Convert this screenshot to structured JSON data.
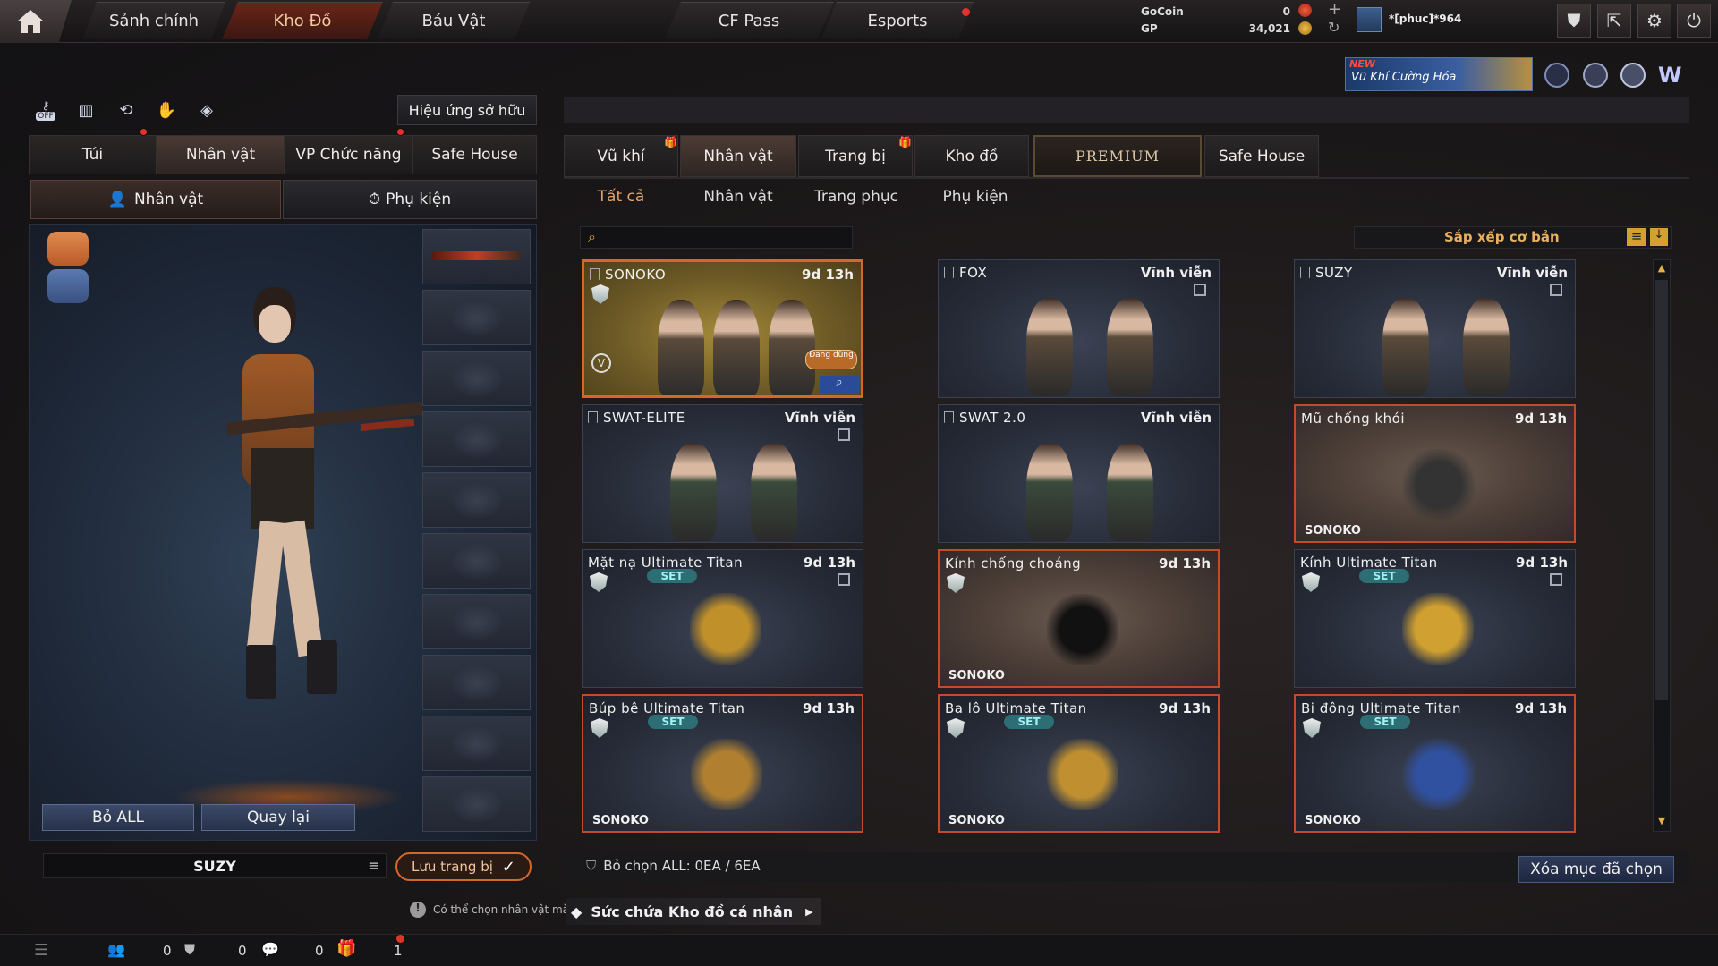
{
  "nav": {
    "tabs": [
      "Sảnh chính",
      "Kho Đồ",
      "Báu Vật",
      "CF Pass",
      "Esports"
    ],
    "active_tab": "Kho Đồ"
  },
  "currency": {
    "gocoin_label": "GoCoin",
    "gocoin_value": "0",
    "gp_label": "GP",
    "gp_value": "34,021"
  },
  "user": {
    "name": "*[phuc]*964"
  },
  "promo": {
    "badge": "NEW",
    "text": "Vũ Khí Cường Hóa"
  },
  "left": {
    "off_label": "OFF",
    "effects_button": "Hiệu ứng sở hữu",
    "tabs": [
      "Túi",
      "Nhân vật",
      "VP Chức năng",
      "Safe House"
    ],
    "active_tab": "Nhân vật",
    "subtabs": [
      "Nhân vật",
      "Phụ kiện"
    ],
    "remove_all": "Bỏ ALL",
    "back": "Quay lại",
    "character_name": "SUZY",
    "save_equip": "Lưu trang bị",
    "tip": "Có thể chọn nhân vật mà"
  },
  "right": {
    "tabs": [
      "Vũ khí",
      "Nhân vật",
      "Trang bị",
      "Kho đồ",
      "PREMIUM",
      "Safe House"
    ],
    "active_tab": "Nhân vật",
    "subtabs": [
      "Tất cả",
      "Nhân vật",
      "Trang phục",
      "Phụ kiện"
    ],
    "active_subtab": "Tất cả",
    "search_placeholder": "",
    "sort_label": "Sắp xếp cơ bản",
    "items": [
      {
        "name": "SONOKO",
        "duration": "9d 13h",
        "in_use": "Đang dùng"
      },
      {
        "name": "FOX",
        "duration": "Vĩnh viễn"
      },
      {
        "name": "SUZY",
        "duration": "Vĩnh viễn"
      },
      {
        "name": "SWAT-ELITE",
        "duration": "Vĩnh viễn"
      },
      {
        "name": "SWAT 2.0",
        "duration": "Vĩnh viễn"
      },
      {
        "name": "Mũ chống khói",
        "duration": "9d 13h",
        "owner": "SONOKO"
      },
      {
        "name": "Mặt nạ Ultimate Titan",
        "duration": "9d 13h",
        "set": "SET"
      },
      {
        "name": "Kính chống choáng",
        "duration": "9d 13h",
        "owner": "SONOKO"
      },
      {
        "name": "Kính Ultimate Titan",
        "duration": "9d 13h",
        "set": "SET"
      },
      {
        "name": "Búp bê Ultimate Titan",
        "duration": "9d 13h",
        "set": "SET",
        "owner": "SONOKO"
      },
      {
        "name": "Ba lô Ultimate Titan",
        "duration": "9d 13h",
        "set": "SET",
        "owner": "SONOKO"
      },
      {
        "name": "Bi đông Ultimate Titan",
        "duration": "9d 13h",
        "set": "SET",
        "owner": "SONOKO"
      }
    ],
    "deselect_all": "Bỏ chọn ALL: 0EA / 6EA",
    "delete_selected": "Xóa mục đã chọn",
    "capacity": "Sức chứa Kho đồ cá nhân"
  },
  "bottom": {
    "counts": [
      "0",
      "0",
      "0",
      "1"
    ]
  },
  "colors": {
    "accent": "#d4672a",
    "set_badge": "#2c6e74",
    "alert": "#e2322b"
  }
}
